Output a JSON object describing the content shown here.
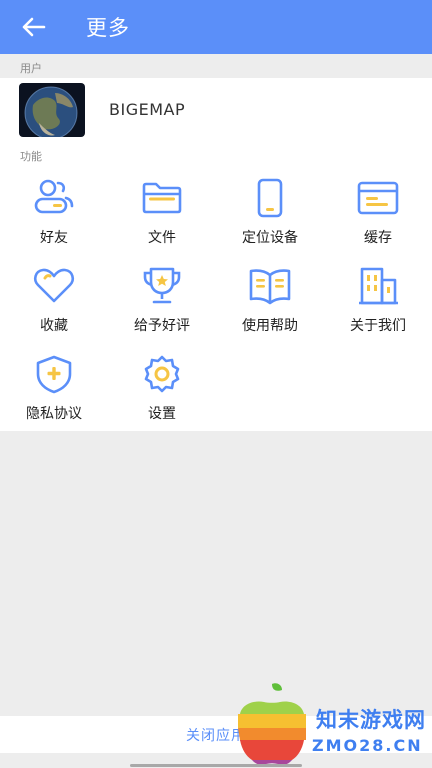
{
  "header": {
    "title": "更多",
    "back_icon": "arrow-left-icon"
  },
  "user_section": {
    "label": "用户",
    "username": "BIGEMAP",
    "avatar": "earth-globe-avatar"
  },
  "function_section": {
    "label": "功能",
    "items": [
      {
        "label": "好友",
        "icon": "friends-icon"
      },
      {
        "label": "文件",
        "icon": "folder-icon"
      },
      {
        "label": "定位设备",
        "icon": "phone-device-icon"
      },
      {
        "label": "缓存",
        "icon": "cache-card-icon"
      },
      {
        "label": "收藏",
        "icon": "heart-icon"
      },
      {
        "label": "给予好评",
        "icon": "trophy-icon"
      },
      {
        "label": "使用帮助",
        "icon": "book-icon"
      },
      {
        "label": "关于我们",
        "icon": "building-icon"
      },
      {
        "label": "隐私协议",
        "icon": "shield-icon"
      },
      {
        "label": "设置",
        "icon": "gear-icon"
      }
    ]
  },
  "footer": {
    "close_label": "关闭应用"
  },
  "watermark": {
    "cn": "知末游戏网",
    "en": "ZMO28.CN"
  },
  "colors": {
    "primary": "#5b8ff9",
    "accent": "#f6c544",
    "background": "#ededed"
  }
}
